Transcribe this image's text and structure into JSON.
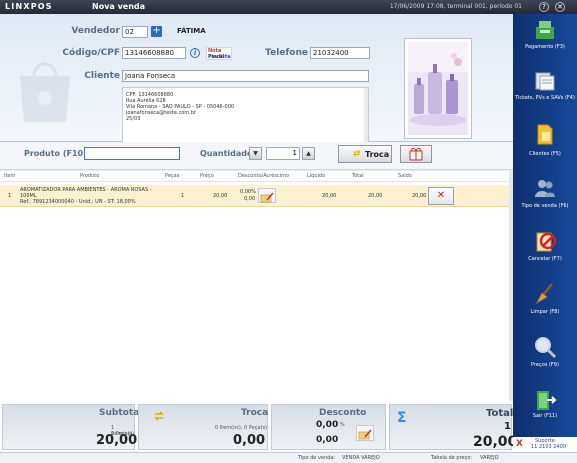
{
  "titlebar": {
    "logo": "LINXPOS",
    "window_title": "Nova venda",
    "status": "17/06/2009 17:08, terminal 001, período 01",
    "close": "✕",
    "help": "?"
  },
  "customer": {
    "vendedor_label": "Vendedor",
    "vendedor_code": "02",
    "vendedor_name": "FÁTIMA",
    "cpf_label": "Código/CPF",
    "cpf_value": "13146608880",
    "telefone_label": "Telefone",
    "telefone_value": "21032400",
    "cliente_label": "Cliente",
    "cliente_value": "Joana Fonseca",
    "nota_logo_top": "Nota Fiscal",
    "nota_logo_bottom": "Paulista",
    "details": [
      "CPF: 13146608880",
      "Rua Aurélia 628",
      "Vila Romana - SAO PAULO - SP - 05046-000",
      "joanafonseca@teste.com.br",
      "25/03"
    ]
  },
  "product": {
    "label": "Produto (F10)",
    "value": "",
    "qty_label": "Quantidade",
    "qty_value": "1",
    "troca_button": "Troca"
  },
  "table": {
    "headers": {
      "item": "Item",
      "produto": "Produto",
      "pecas": "Peças",
      "preco": "Preço",
      "desconto": "Desconto/Acréscimo",
      "liquido": "Líquido",
      "total": "Total",
      "saldo": "Saldo"
    },
    "rows": [
      {
        "item": "1",
        "desc1": "AROMATIZADOR PARA AMBIENTES - AROMA ROSAS -",
        "desc2": "100ML",
        "desc3": "Ref.: 7891234000040 - Unid.: UN - ST: 18,00%",
        "pecas": "1",
        "preco": "20,00",
        "desc_pct": "0,00%",
        "desc_val": "0,00",
        "liquido": "20,00",
        "total": "20,00",
        "saldo": "20,00",
        "delete": "✕"
      }
    ]
  },
  "totals": {
    "subtotal_label": "Subtotal",
    "subtotal_items": "1 Item(ns)",
    "subtotal_pieces": "1 Peça(s)",
    "subtotal_value": "20,00",
    "troca_label": "Troca",
    "troca_items": "0 Item(ns), 0 Peça(s)",
    "troca_value": "0,00",
    "desconto_label": "Desconto",
    "desconto_value1": "0,00",
    "desconto_pct": "%",
    "desconto_value2": "0,00",
    "total_label": "Total",
    "total_items": "1",
    "total_value": "20,00",
    "sigma": "Σ"
  },
  "footer": {
    "tipo_venda_label": "Tipo de venda:",
    "tipo_venda_value": "VENDA VAREJO",
    "tabela_label": "Tabela de preço:",
    "tabela_value": "VAREJO"
  },
  "sidebar": {
    "items": [
      {
        "label": "Pagamento (F3)",
        "icon": "cash-register-icon"
      },
      {
        "label": "Tickets, PVs e SAVs (F4)",
        "icon": "tickets-icon"
      },
      {
        "label": "Clientes (F5)",
        "icon": "folder-icon"
      },
      {
        "label": "Tipo de venda (F6)",
        "icon": "people-icon"
      },
      {
        "label": "Cancelar (F7)",
        "icon": "cancel-icon"
      },
      {
        "label": "Limpar (F8)",
        "icon": "broom-icon"
      },
      {
        "label": "Preços (F9)",
        "icon": "magnifier-icon"
      },
      {
        "label": "Sair (F11)",
        "icon": "exit-icon"
      }
    ],
    "support_label": "Suporte",
    "support_phone": "11 2103 2400"
  }
}
